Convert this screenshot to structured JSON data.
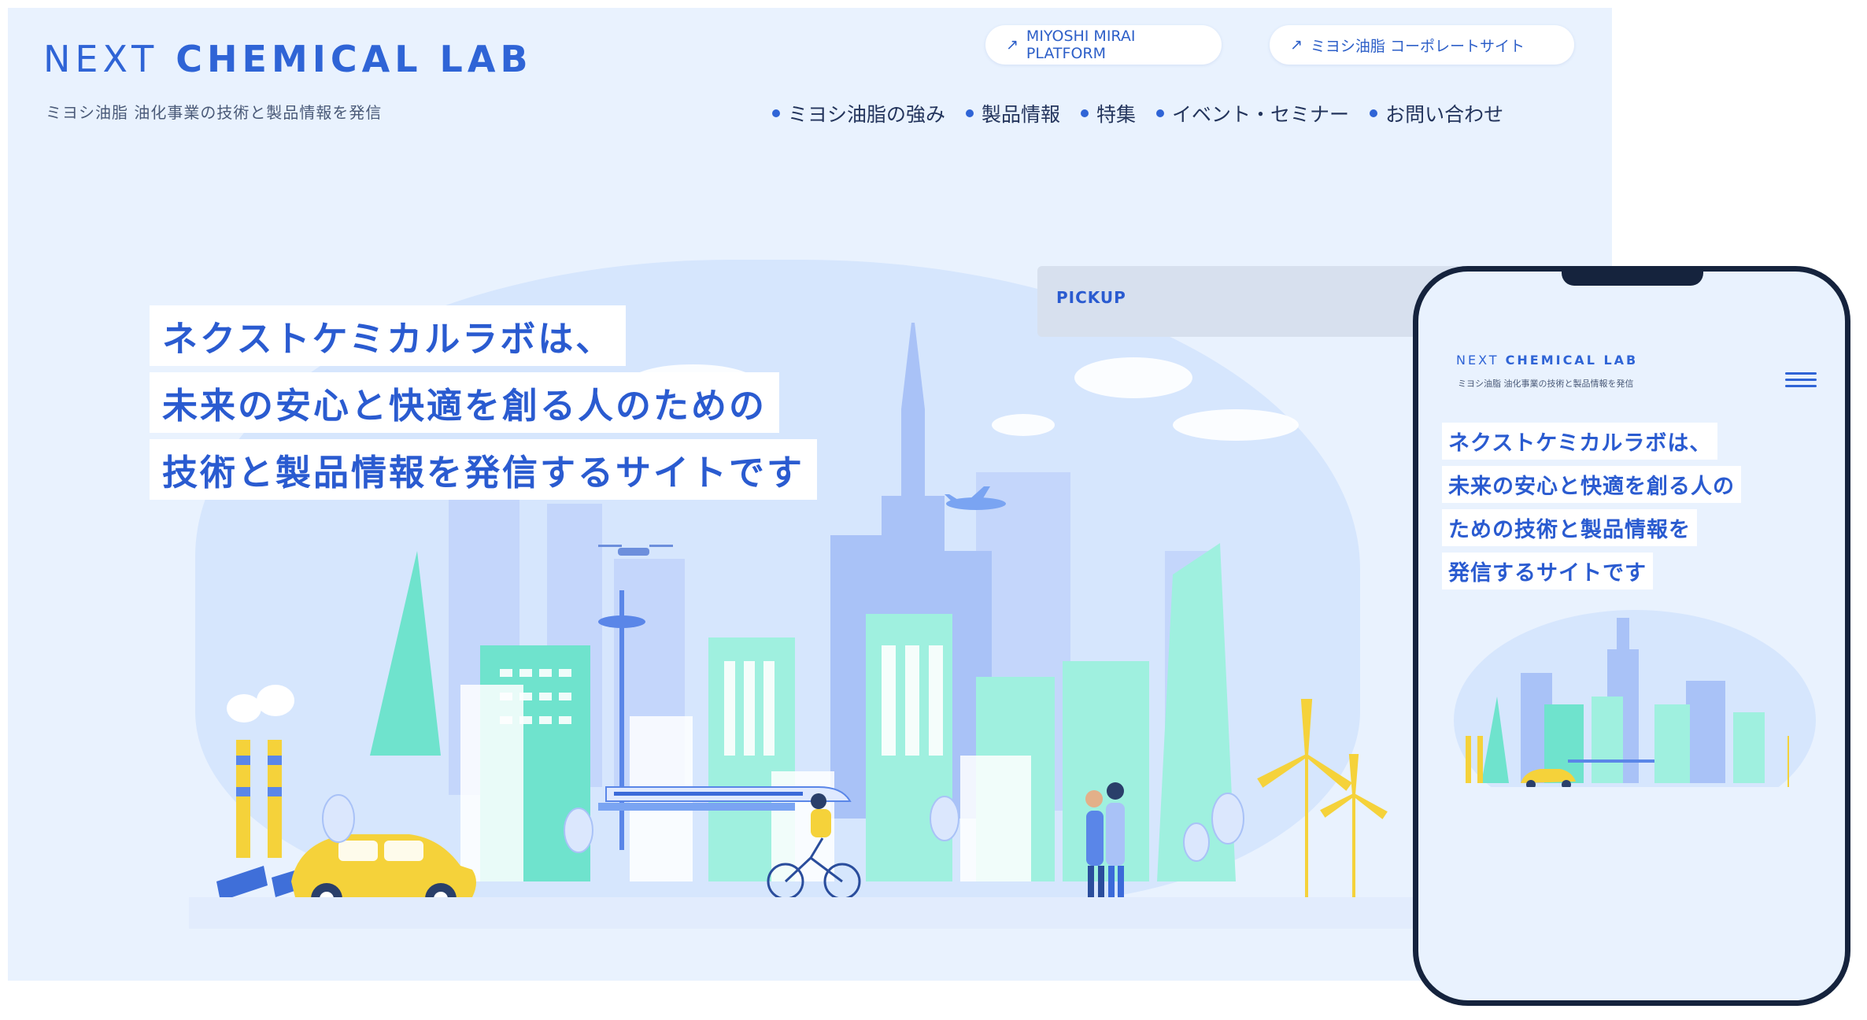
{
  "desktop": {
    "logo_thin": "NEXT",
    "logo_bold": "CHEMICAL LAB",
    "tagline": "ミヨシ油脂 油化事業の技術と製品情報を発信",
    "links": [
      {
        "label": "MIYOSHI MIRAI PLATFORM",
        "icon": "external-link-icon"
      },
      {
        "label": "ミヨシ油脂 コーポレートサイト",
        "icon": "external-link-icon"
      }
    ],
    "nav": [
      "ミヨシ油脂の強み",
      "製品情報",
      "特集",
      "イベント・セミナー",
      "お問い合わせ"
    ],
    "headline": [
      "ネクストケミカルラボは、",
      "未来の安心と快適を創る人のための",
      "技術と製品情報を発信するサイトです"
    ],
    "pickup": "PICKUP"
  },
  "mobile": {
    "logo_thin": "NEXT",
    "logo_bold": "CHEMICAL LAB",
    "tagline": "ミヨシ油脂 油化事業の技術と製品情報を発信",
    "menu_icon": "hamburger-icon",
    "headline": [
      "ネクストケミカルラボは、",
      "未来の安心と快適を創る人の",
      "ための技術と製品情報を",
      "発信するサイトです"
    ]
  },
  "colors": {
    "brand": "#2f64d6",
    "background": "#e9f2fe",
    "accent_yellow": "#f5d23a",
    "teal": "#5fe0c8"
  }
}
